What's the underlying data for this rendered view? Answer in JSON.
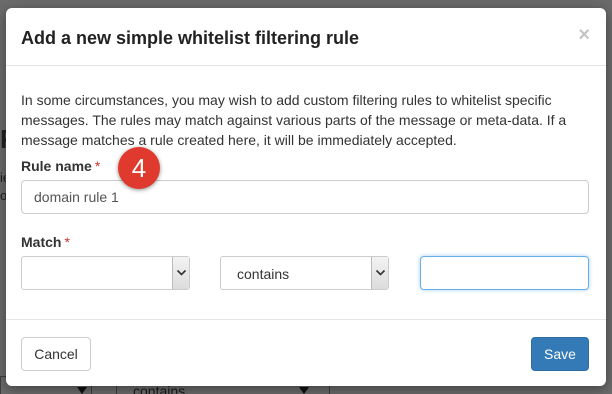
{
  "background": {
    "heading_fragment": "Fi",
    "line_fragment_1": "ie",
    "line_fragment_2": "oc",
    "select_value": "contains"
  },
  "modal": {
    "title": "Add a new simple whitelist filtering rule",
    "close_glyph": "×",
    "description": "In some circumstances, you may wish to add custom filtering rules to whitelist specific messages. The rules may match against various parts of the message or meta-data. If a message matches a rule created here, it will be immediately accepted.",
    "rule_name": {
      "label": "Rule name",
      "required_marker": "*",
      "value": "domain rule 1"
    },
    "match": {
      "label": "Match",
      "required_marker": "*",
      "field_value": "",
      "operator_value": "contains",
      "value_input": ""
    },
    "annotation_badge": "4",
    "buttons": {
      "cancel": "Cancel",
      "save": "Save"
    }
  },
  "colors": {
    "primary": "#337ab7",
    "badge": "#e03a2f",
    "required": "#c9302c",
    "focus_border": "#66afe9"
  }
}
